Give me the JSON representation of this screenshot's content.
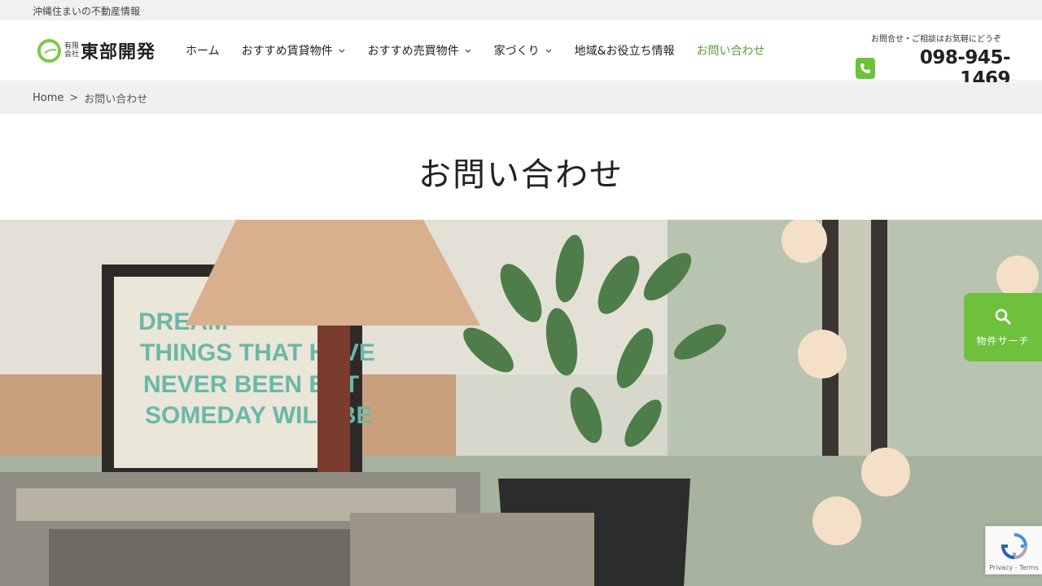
{
  "topbar": {
    "tagline": "沖縄住まいの不動産情報"
  },
  "logo": {
    "small_top": "有限",
    "small_bottom": "会社",
    "name": "東部開発"
  },
  "nav": {
    "items": [
      {
        "label": "ホーム"
      },
      {
        "label": "おすすめ賃貸物件"
      },
      {
        "label": "おすすめ売買物件"
      },
      {
        "label": "家づくり"
      },
      {
        "label": "地域&お役立ち情報"
      },
      {
        "label": "お問い合わせ"
      }
    ]
  },
  "contact": {
    "note": "お問合せ・ご相談はお気軽にどうぞ",
    "phone": "098-945-1469"
  },
  "breadcrumb": {
    "home": "Home",
    "separator": ">",
    "current": "お問い合わせ"
  },
  "page": {
    "title": "お問い合わせ"
  },
  "hero": {
    "sign_lines": [
      "DREAM",
      "THINGS THAT HAVE",
      "NEVER BEEN BUT",
      "SOMEDAY WILL BE"
    ]
  },
  "search_tab": {
    "label": "物件サーチ"
  },
  "recaptcha": {
    "text": "Privacy - Terms"
  },
  "colors": {
    "accent": "#6ec13c",
    "active_nav": "#5a9c3b",
    "breadcrumb_bg": "#f0f0f0"
  }
}
